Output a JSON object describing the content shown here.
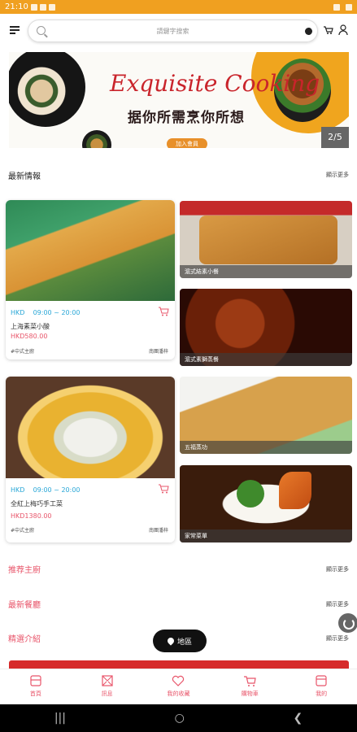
{
  "status_bar": {
    "time": "21:10"
  },
  "search": {
    "placeholder": "請鍵字搜索"
  },
  "banner": {
    "title": "Exquisite Cooking",
    "subtitle": "据你所需烹你所想",
    "cta": "加入會員",
    "pager": "2/5"
  },
  "latest": {
    "title": "最新情報",
    "more": "顯示更多"
  },
  "cards": [
    {
      "currency": "HKD",
      "hours": "09:00 ~ 20:00",
      "name": "上海素菜小酸",
      "price": "HKD580.00",
      "category": "#中式主廚",
      "shop": "南團潘梓"
    },
    {
      "currency": "HKD",
      "hours": "09:00 ~ 20:00",
      "name": "全紅上梅巧手工菜",
      "price": "HKD1380.00",
      "category": "#中式主廚",
      "shop": "南團潘梓"
    }
  ],
  "tiles": [
    {
      "label": "滬式結素小餐"
    },
    {
      "label": "滬式素獅蒸餐"
    },
    {
      "label": "五福蒸功"
    },
    {
      "label": "家常菜單"
    }
  ],
  "sections": [
    {
      "title": "推荐主廚",
      "more": "顯示更多"
    },
    {
      "title": "最新餐廳",
      "more": "顯示更多"
    },
    {
      "title": "精選介紹",
      "more": "顯示更多"
    }
  ],
  "map_button": "地區",
  "tabbar": [
    {
      "label": "首頁",
      "icon": "home-icon"
    },
    {
      "label": "訊息",
      "icon": "mail-icon"
    },
    {
      "label": "我的收藏",
      "icon": "heart-icon"
    },
    {
      "label": "購物車",
      "icon": "cart-icon"
    },
    {
      "label": "我的",
      "icon": "profile-icon"
    }
  ],
  "colors": {
    "accent": "#e8556a",
    "status_bar": "#f0a020",
    "time": "#2aa7d7"
  }
}
